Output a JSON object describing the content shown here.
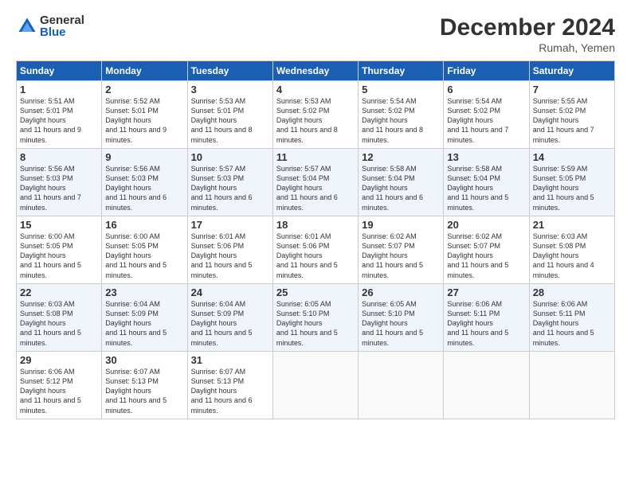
{
  "logo": {
    "general": "General",
    "blue": "Blue"
  },
  "title": "December 2024",
  "location": "Rumah, Yemen",
  "days_header": [
    "Sunday",
    "Monday",
    "Tuesday",
    "Wednesday",
    "Thursday",
    "Friday",
    "Saturday"
  ],
  "weeks": [
    [
      {
        "day": "1",
        "rise": "5:51 AM",
        "set": "5:01 PM",
        "hours": "11 hours and 9 minutes."
      },
      {
        "day": "2",
        "rise": "5:52 AM",
        "set": "5:01 PM",
        "hours": "11 hours and 9 minutes."
      },
      {
        "day": "3",
        "rise": "5:53 AM",
        "set": "5:01 PM",
        "hours": "11 hours and 8 minutes."
      },
      {
        "day": "4",
        "rise": "5:53 AM",
        "set": "5:02 PM",
        "hours": "11 hours and 8 minutes."
      },
      {
        "day": "5",
        "rise": "5:54 AM",
        "set": "5:02 PM",
        "hours": "11 hours and 8 minutes."
      },
      {
        "day": "6",
        "rise": "5:54 AM",
        "set": "5:02 PM",
        "hours": "11 hours and 7 minutes."
      },
      {
        "day": "7",
        "rise": "5:55 AM",
        "set": "5:02 PM",
        "hours": "11 hours and 7 minutes."
      }
    ],
    [
      {
        "day": "8",
        "rise": "5:56 AM",
        "set": "5:03 PM",
        "hours": "11 hours and 7 minutes."
      },
      {
        "day": "9",
        "rise": "5:56 AM",
        "set": "5:03 PM",
        "hours": "11 hours and 6 minutes."
      },
      {
        "day": "10",
        "rise": "5:57 AM",
        "set": "5:03 PM",
        "hours": "11 hours and 6 minutes."
      },
      {
        "day": "11",
        "rise": "5:57 AM",
        "set": "5:04 PM",
        "hours": "11 hours and 6 minutes."
      },
      {
        "day": "12",
        "rise": "5:58 AM",
        "set": "5:04 PM",
        "hours": "11 hours and 6 minutes."
      },
      {
        "day": "13",
        "rise": "5:58 AM",
        "set": "5:04 PM",
        "hours": "11 hours and 5 minutes."
      },
      {
        "day": "14",
        "rise": "5:59 AM",
        "set": "5:05 PM",
        "hours": "11 hours and 5 minutes."
      }
    ],
    [
      {
        "day": "15",
        "rise": "6:00 AM",
        "set": "5:05 PM",
        "hours": "11 hours and 5 minutes."
      },
      {
        "day": "16",
        "rise": "6:00 AM",
        "set": "5:05 PM",
        "hours": "11 hours and 5 minutes."
      },
      {
        "day": "17",
        "rise": "6:01 AM",
        "set": "5:06 PM",
        "hours": "11 hours and 5 minutes."
      },
      {
        "day": "18",
        "rise": "6:01 AM",
        "set": "5:06 PM",
        "hours": "11 hours and 5 minutes."
      },
      {
        "day": "19",
        "rise": "6:02 AM",
        "set": "5:07 PM",
        "hours": "11 hours and 5 minutes."
      },
      {
        "day": "20",
        "rise": "6:02 AM",
        "set": "5:07 PM",
        "hours": "11 hours and 5 minutes."
      },
      {
        "day": "21",
        "rise": "6:03 AM",
        "set": "5:08 PM",
        "hours": "11 hours and 4 minutes."
      }
    ],
    [
      {
        "day": "22",
        "rise": "6:03 AM",
        "set": "5:08 PM",
        "hours": "11 hours and 5 minutes."
      },
      {
        "day": "23",
        "rise": "6:04 AM",
        "set": "5:09 PM",
        "hours": "11 hours and 5 minutes."
      },
      {
        "day": "24",
        "rise": "6:04 AM",
        "set": "5:09 PM",
        "hours": "11 hours and 5 minutes."
      },
      {
        "day": "25",
        "rise": "6:05 AM",
        "set": "5:10 PM",
        "hours": "11 hours and 5 minutes."
      },
      {
        "day": "26",
        "rise": "6:05 AM",
        "set": "5:10 PM",
        "hours": "11 hours and 5 minutes."
      },
      {
        "day": "27",
        "rise": "6:06 AM",
        "set": "5:11 PM",
        "hours": "11 hours and 5 minutes."
      },
      {
        "day": "28",
        "rise": "6:06 AM",
        "set": "5:11 PM",
        "hours": "11 hours and 5 minutes."
      }
    ],
    [
      {
        "day": "29",
        "rise": "6:06 AM",
        "set": "5:12 PM",
        "hours": "11 hours and 5 minutes."
      },
      {
        "day": "30",
        "rise": "6:07 AM",
        "set": "5:13 PM",
        "hours": "11 hours and 5 minutes."
      },
      {
        "day": "31",
        "rise": "6:07 AM",
        "set": "5:13 PM",
        "hours": "11 hours and 6 minutes."
      },
      null,
      null,
      null,
      null
    ]
  ]
}
